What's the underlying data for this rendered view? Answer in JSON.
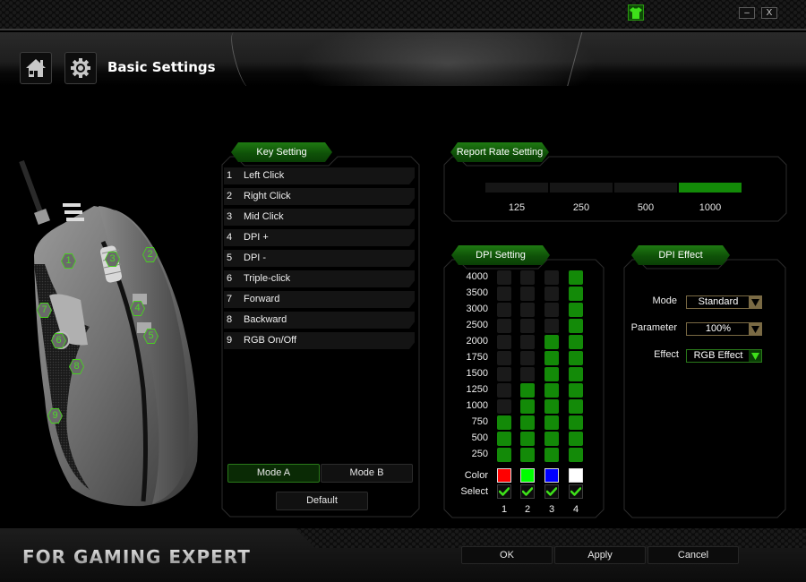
{
  "window": {
    "app_icon": "shirt-icon",
    "minimize_label": "–",
    "close_label": "X"
  },
  "header": {
    "home_icon": "home-icon",
    "settings_icon": "gear-icon",
    "title": "Basic Settings"
  },
  "mouse_image": {
    "labels": [
      "1",
      "2",
      "3",
      "4",
      "5",
      "6",
      "7",
      "8",
      "9"
    ]
  },
  "key_setting": {
    "tab_label": "Key Setting",
    "keys": [
      {
        "num": "1",
        "label": "Left Click"
      },
      {
        "num": "2",
        "label": "Right Click"
      },
      {
        "num": "3",
        "label": "Mid Click"
      },
      {
        "num": "4",
        "label": "DPI +"
      },
      {
        "num": "5",
        "label": "DPI -"
      },
      {
        "num": "6",
        "label": "Triple-click"
      },
      {
        "num": "7",
        "label": "Forward"
      },
      {
        "num": "8",
        "label": "Backward"
      },
      {
        "num": "9",
        "label": "RGB On/Off"
      }
    ],
    "mode_a_label": "Mode A",
    "mode_b_label": "Mode B",
    "active_mode": "Mode A",
    "default_label": "Default"
  },
  "report_rate": {
    "tab_label": "Report Rate Setting",
    "options": [
      "125",
      "250",
      "500",
      "1000"
    ],
    "selected": "1000"
  },
  "dpi_setting": {
    "tab_label": "DPI Setting",
    "levels": [
      "4000",
      "3500",
      "3000",
      "2500",
      "2000",
      "1750",
      "1500",
      "1250",
      "1000",
      "750",
      "500",
      "250"
    ],
    "columns": [
      {
        "num": "1",
        "dpi": 750,
        "color": "#ff0000",
        "selected": true
      },
      {
        "num": "2",
        "dpi": 1250,
        "color": "#00ff00",
        "selected": true
      },
      {
        "num": "3",
        "dpi": 2000,
        "color": "#0000ff",
        "selected": true
      },
      {
        "num": "4",
        "dpi": 4000,
        "color": "#ffffff",
        "selected": true
      }
    ],
    "color_label": "Color",
    "select_label": "Select",
    "active_color": "#138a08"
  },
  "dpi_effect": {
    "tab_label": "DPI Effect",
    "mode_label": "Mode",
    "mode_value": "Standard",
    "parameter_label": "Parameter",
    "parameter_value": "100%",
    "effect_label": "Effect",
    "effect_value": "RGB Effect"
  },
  "footer": {
    "tagline": "FOR GAMING EXPERT",
    "ok_label": "OK",
    "apply_label": "Apply",
    "cancel_label": "Cancel"
  }
}
